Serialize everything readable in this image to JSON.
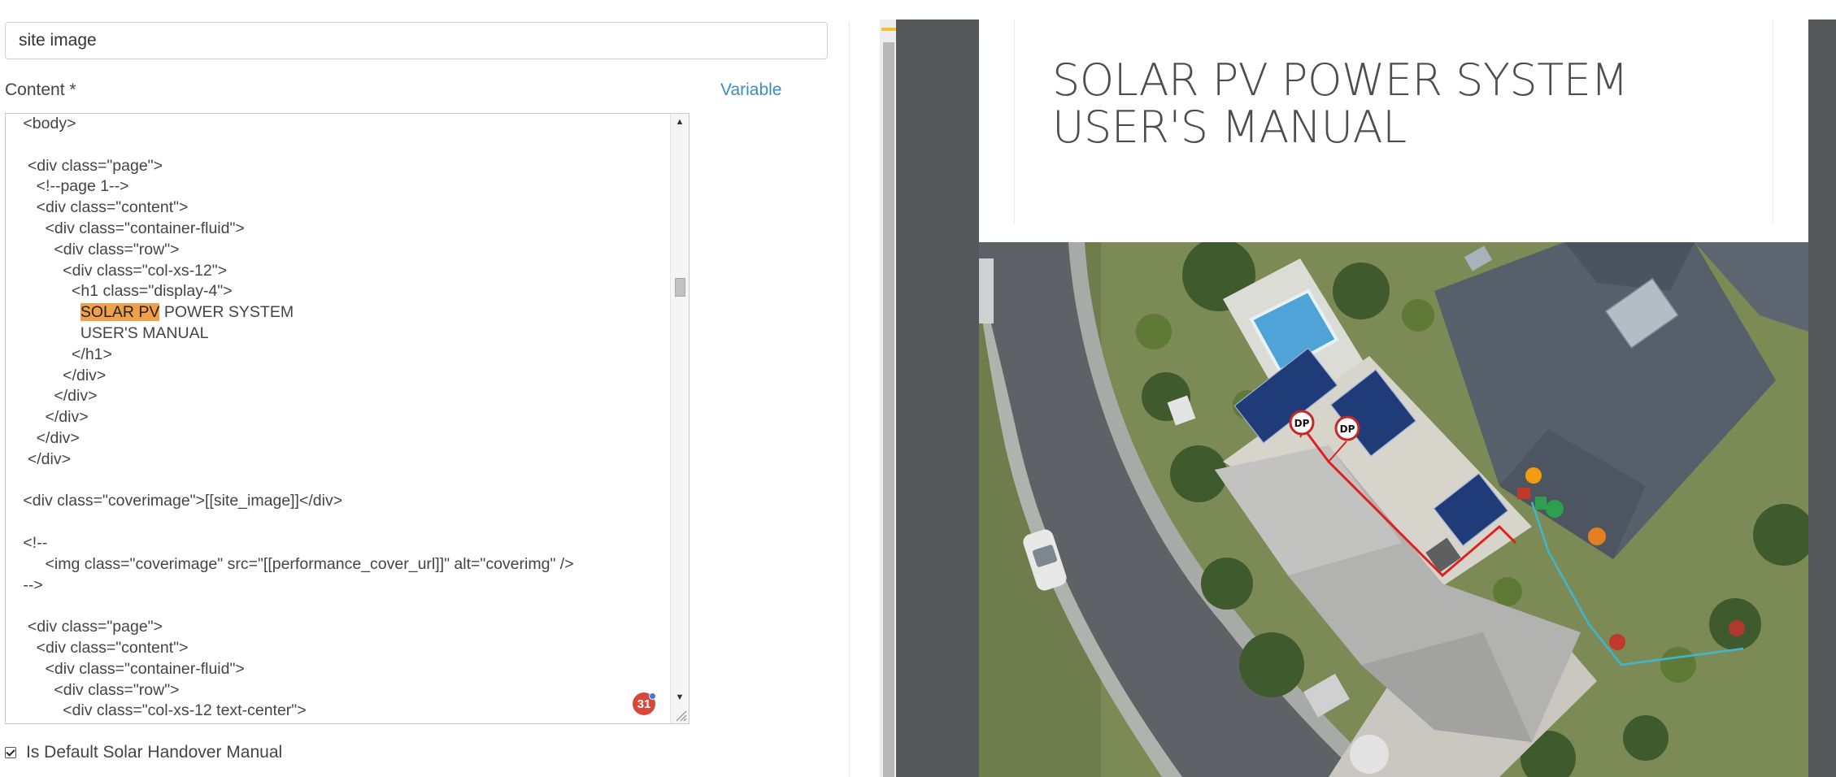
{
  "form": {
    "name_value": "site image",
    "content_label": "Content *",
    "variable_label": "Variable",
    "default_label": "Is Default Solar Handover Manual",
    "default_checked": true
  },
  "editor": {
    "lines": [
      {
        "pre": " <body>",
        "hl": "",
        "post": ""
      },
      {
        "pre": "",
        "hl": "",
        "post": ""
      },
      {
        "pre": "  <div class=\"page\">",
        "hl": "",
        "post": ""
      },
      {
        "pre": "    <!--page 1-->",
        "hl": "",
        "post": ""
      },
      {
        "pre": "    <div class=\"content\">",
        "hl": "",
        "post": ""
      },
      {
        "pre": "      <div class=\"container-fluid\">",
        "hl": "",
        "post": ""
      },
      {
        "pre": "        <div class=\"row\">",
        "hl": "",
        "post": ""
      },
      {
        "pre": "          <div class=\"col-xs-12\">",
        "hl": "",
        "post": ""
      },
      {
        "pre": "            <h1 class=\"display-4\">",
        "hl": "",
        "post": ""
      },
      {
        "pre": "              ",
        "hl": "SOLAR PV",
        "post": " POWER SYSTEM"
      },
      {
        "pre": "              USER'S MANUAL",
        "hl": "",
        "post": ""
      },
      {
        "pre": "            </h1>",
        "hl": "",
        "post": ""
      },
      {
        "pre": "          </div>",
        "hl": "",
        "post": ""
      },
      {
        "pre": "        </div>",
        "hl": "",
        "post": ""
      },
      {
        "pre": "      </div>",
        "hl": "",
        "post": ""
      },
      {
        "pre": "    </div>",
        "hl": "",
        "post": ""
      },
      {
        "pre": "  </div>",
        "hl": "",
        "post": ""
      },
      {
        "pre": "",
        "hl": "",
        "post": ""
      },
      {
        "pre": " <div class=\"coverimage\">[[site_image]]</div>",
        "hl": "",
        "post": ""
      },
      {
        "pre": "",
        "hl": "",
        "post": ""
      },
      {
        "pre": " <!--",
        "hl": "",
        "post": ""
      },
      {
        "pre": "      <img class=\"coverimage\" src=\"[[performance_cover_url]]\" alt=\"coverimg\" />",
        "hl": "",
        "post": ""
      },
      {
        "pre": " -->",
        "hl": "",
        "post": ""
      },
      {
        "pre": "",
        "hl": "",
        "post": ""
      },
      {
        "pre": "  <div class=\"page\">",
        "hl": "",
        "post": ""
      },
      {
        "pre": "    <div class=\"content\">",
        "hl": "",
        "post": ""
      },
      {
        "pre": "      <div class=\"container-fluid\">",
        "hl": "",
        "post": ""
      },
      {
        "pre": "        <div class=\"row\">",
        "hl": "",
        "post": ""
      },
      {
        "pre": "          <div class=\"col-xs-12 text-center\">",
        "hl": "",
        "post": ""
      }
    ],
    "badge_count": "31",
    "highlight_color": "#f0a04b"
  },
  "preview": {
    "title_line1": "SOLAR PV POWER SYSTEM",
    "title_line2": "USER'S MANUAL",
    "cover_image": "aerial-site-image",
    "markers": [
      "DP",
      "DP"
    ],
    "colors": {
      "string_line": "#e02020",
      "cable_line": "#3fb6d0",
      "panel": "#1f3b78"
    }
  }
}
